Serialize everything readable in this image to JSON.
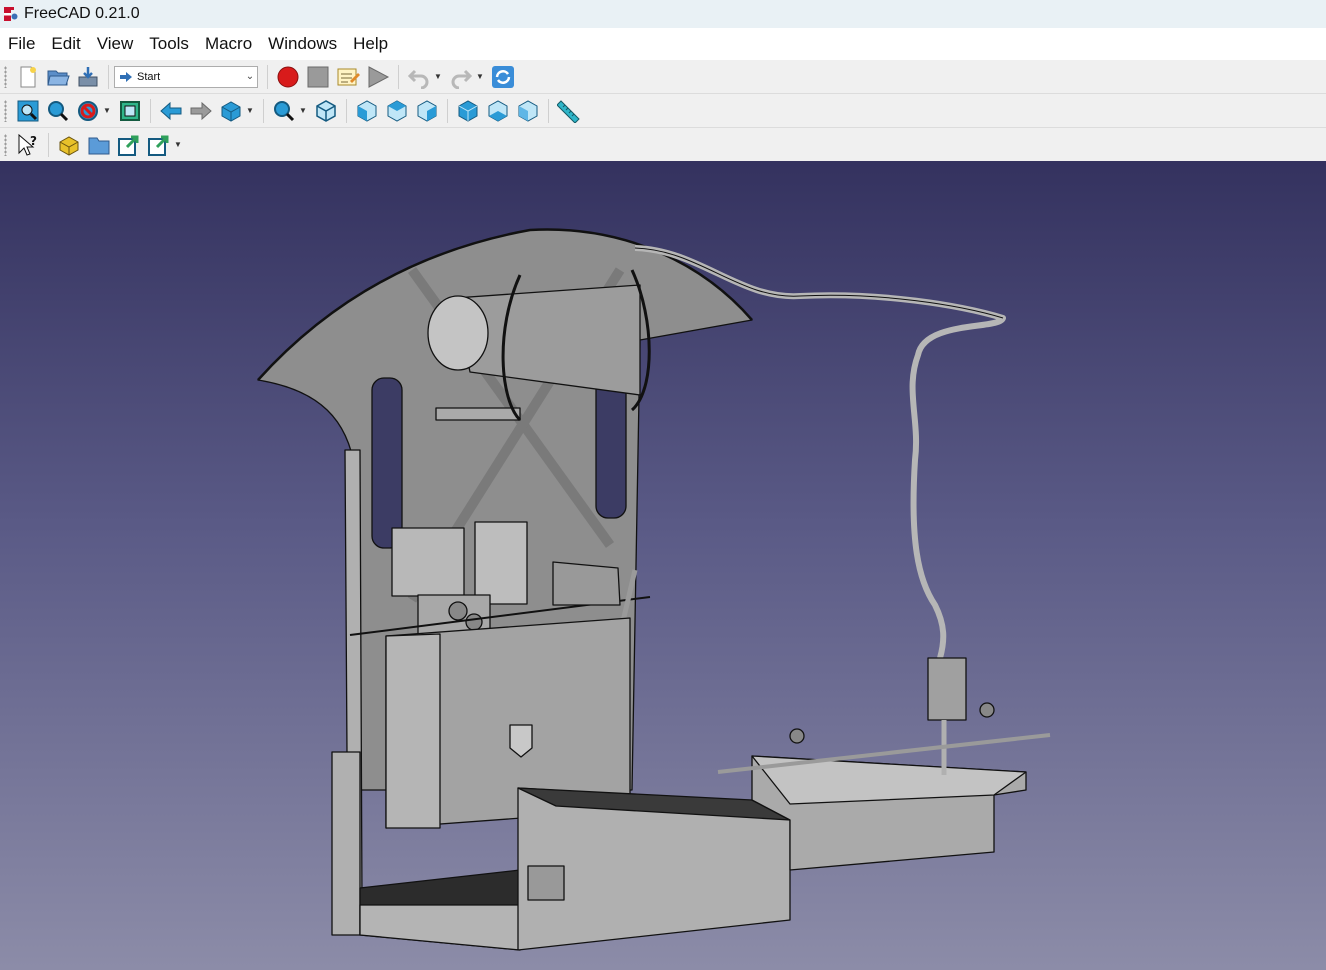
{
  "window": {
    "title": "FreeCAD 0.21.0"
  },
  "menu": [
    "File",
    "Edit",
    "View",
    "Tools",
    "Macro",
    "Windows",
    "Help"
  ],
  "toolbar": {
    "workbench_selected": "Start"
  },
  "icons": {
    "file": [
      "new-document-icon",
      "open-document-icon",
      "save-document-icon"
    ],
    "macro": [
      "macro-record-icon",
      "macro-stop-icon",
      "macro-edit-icon",
      "macro-run-icon"
    ],
    "edit": [
      "undo-icon",
      "redo-icon",
      "refresh-icon"
    ],
    "view": [
      "fit-all-icon",
      "fit-selection-icon",
      "draw-style-icon",
      "bounding-box-icon",
      "back-icon",
      "forward-icon",
      "std-views-icon",
      "zoom-icon",
      "isometric-view-icon",
      "front-view-icon",
      "top-view-icon",
      "right-view-icon",
      "rear-view-icon",
      "bottom-view-icon",
      "left-view-icon",
      "measure-icon"
    ],
    "structure": [
      "whats-this-icon",
      "create-part-icon",
      "create-group-icon",
      "create-link-icon",
      "link-actions-icon"
    ]
  },
  "colors": {
    "viewport_top": "#34325f",
    "viewport_bottom": "#8c8ca8",
    "model_fill": "#9a9a9a",
    "model_edge": "#111111"
  }
}
